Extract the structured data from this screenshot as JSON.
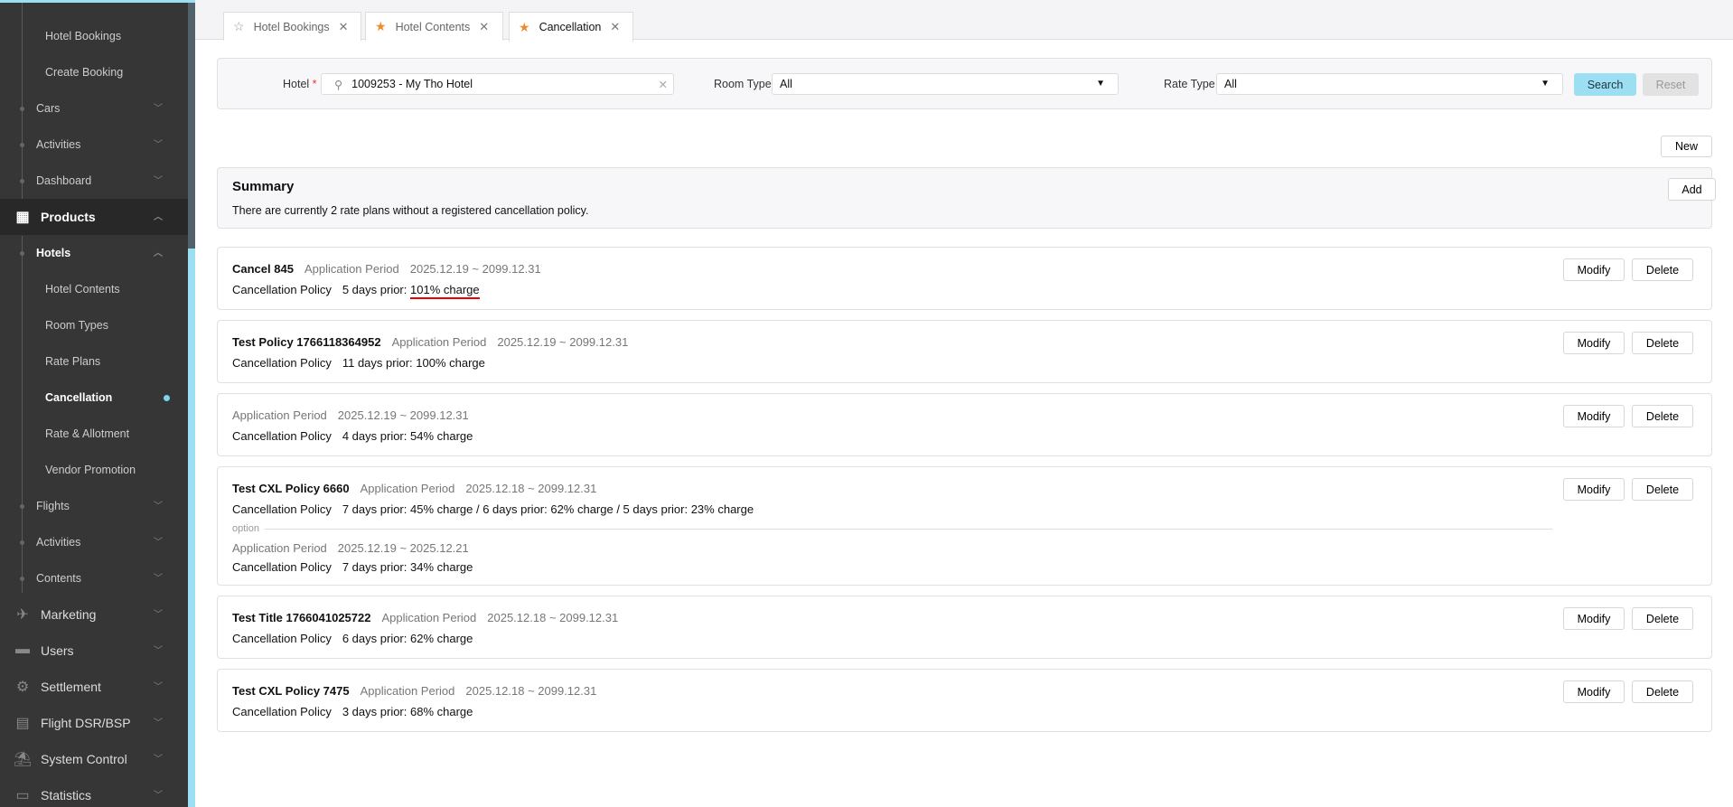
{
  "sidebar": {
    "items": [
      {
        "label": "Hotel Bookings",
        "level": 2
      },
      {
        "label": "Create Booking",
        "level": 2
      },
      {
        "label": "Cars",
        "level": 1
      },
      {
        "label": "Activities",
        "level": 1
      },
      {
        "label": "Dashboard",
        "level": 1
      },
      {
        "label": "Products",
        "level": 0,
        "icon": "hotel-icon",
        "expanded": true
      },
      {
        "label": "Hotels",
        "level": 1,
        "expanded": true
      },
      {
        "label": "Hotel Contents",
        "level": 2
      },
      {
        "label": "Room Types",
        "level": 2
      },
      {
        "label": "Rate Plans",
        "level": 2
      },
      {
        "label": "Cancellation",
        "level": 2,
        "active": true
      },
      {
        "label": "Rate & Allotment",
        "level": 2
      },
      {
        "label": "Vendor Promotion",
        "level": 2
      },
      {
        "label": "Flights",
        "level": 1
      },
      {
        "label": "Activities",
        "level": 1
      },
      {
        "label": "Contents",
        "level": 1
      },
      {
        "label": "Marketing",
        "level": 0,
        "icon": "airplane-icon"
      },
      {
        "label": "Users",
        "level": 0,
        "icon": "briefcase-icon"
      },
      {
        "label": "Settlement",
        "level": 0,
        "icon": "gears-icon"
      },
      {
        "label": "Flight DSR/BSP",
        "level": 0,
        "icon": "receipt-icon"
      },
      {
        "label": "System Control",
        "level": 0,
        "icon": "beach-umbrella-icon"
      },
      {
        "label": "Statistics",
        "level": 0,
        "icon": "monitor-icon"
      }
    ]
  },
  "tabs": [
    {
      "label": "Hotel Bookings",
      "starred": false
    },
    {
      "label": "Hotel Contents",
      "starred": true
    },
    {
      "label": "Cancellation",
      "starred": true,
      "active": true
    }
  ],
  "filter": {
    "hotel_label": "Hotel",
    "hotel_value": "1009253 - My Tho Hotel",
    "room_type_label": "Room Type",
    "room_type_value": "All",
    "rate_type_label": "Rate Type",
    "rate_type_value": "All",
    "search": "Search",
    "reset": "Reset"
  },
  "new_button": "New",
  "summary": {
    "title": "Summary",
    "text": "There are currently 2 rate plans without a registered cancellation policy.",
    "add": "Add"
  },
  "labels": {
    "application_period": "Application Period",
    "cancellation_policy": "Cancellation Policy",
    "option": "option",
    "modify": "Modify",
    "delete": "Delete"
  },
  "policies": [
    {
      "title": "Cancel 845",
      "period": "2025.12.19 ~ 2099.12.31",
      "policy_prefix": "5 days prior: ",
      "policy_highlight": "101% charge"
    },
    {
      "title": "Test Policy 1766118364952",
      "period": "2025.12.19 ~ 2099.12.31",
      "policy": "11 days prior: 100% charge"
    },
    {
      "title": "",
      "period": "2025.12.19 ~ 2099.12.31",
      "policy": "4 days prior: 54% charge"
    },
    {
      "title": "Test CXL Policy 6660",
      "period": "2025.12.18 ~ 2099.12.31",
      "policy": "7 days prior: 45% charge / 6 days prior: 62% charge / 5 days prior: 23% charge",
      "option": {
        "period": "2025.12.19 ~ 2025.12.21",
        "policy": "7 days prior: 34% charge"
      }
    },
    {
      "title": "Test Title 1766041025722",
      "period": "2025.12.18 ~ 2099.12.31",
      "policy": "6 days prior: 62% charge"
    },
    {
      "title": "Test CXL Policy 7475",
      "period": "2025.12.18 ~ 2099.12.31",
      "policy": "3 days prior: 68% charge"
    }
  ]
}
